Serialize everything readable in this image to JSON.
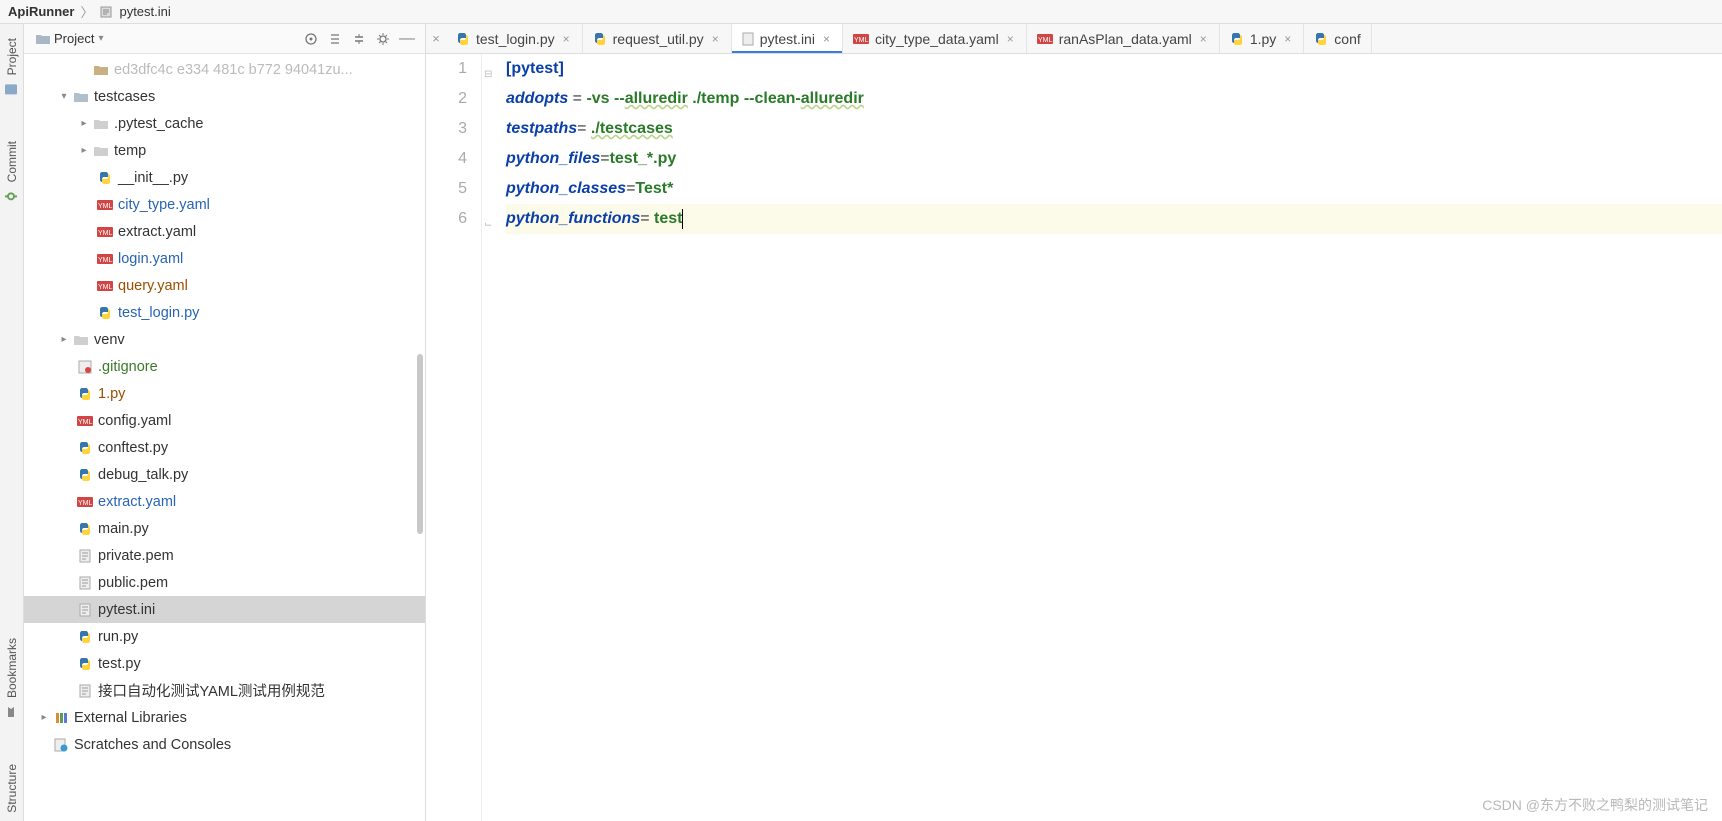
{
  "breadcrumb": {
    "root": "ApiRunner",
    "file": "pytest.ini"
  },
  "leftRail": {
    "project": "Project",
    "commit": "Commit",
    "bookmarks": "Bookmarks",
    "structure": "Structure"
  },
  "paneHeader": {
    "title": "Project"
  },
  "tree": {
    "truncated": "ed3dfc4c e334 481c b772 94041zu...",
    "testcases": "testcases",
    "pytest_cache": ".pytest_cache",
    "temp": "temp",
    "init_py": "__init__.py",
    "city_type_yaml": "city_type.yaml",
    "extract_yaml": "extract.yaml",
    "login_yaml": "login.yaml",
    "query_yaml": "query.yaml",
    "test_login_py": "test_login.py",
    "venv": "venv",
    "gitignore": ".gitignore",
    "one_py": "1.py",
    "config_yaml": "config.yaml",
    "conftest_py": "conftest.py",
    "debug_talk_py": "debug_talk.py",
    "extract_yaml_root": "extract.yaml",
    "main_py": "main.py",
    "private_pem": "private.pem",
    "public_pem": "public.pem",
    "pytest_ini": "pytest.ini",
    "run_py": "run.py",
    "test_py": "test.py",
    "doc_cn": "接口自动化测试YAML测试用例规范",
    "ext_libs": "External Libraries",
    "scratches": "Scratches and Consoles"
  },
  "tabs": [
    {
      "label": "test_login.py",
      "icon": "py"
    },
    {
      "label": "request_util.py",
      "icon": "py"
    },
    {
      "label": "pytest.ini",
      "icon": "ini",
      "active": true
    },
    {
      "label": "city_type_data.yaml",
      "icon": "yml"
    },
    {
      "label": "ranAsPlan_data.yaml",
      "icon": "yml"
    },
    {
      "label": "1.py",
      "icon": "py"
    },
    {
      "label": "conf",
      "icon": "py"
    }
  ],
  "code": {
    "l1_sec": "[pytest]",
    "l2_k": "addopts",
    "l2_op": " = ",
    "l2_v1": "-vs --",
    "l2_v2": "alluredir",
    "l2_v3": " ./temp --clean-",
    "l2_v4": "alluredir",
    "l3_k": "testpaths",
    "l3_op": "= ",
    "l3_v": "./testcases",
    "l4_k": "python_files",
    "l4_op": "=",
    "l4_v": "test_*.py",
    "l5_k": "python_classes",
    "l5_op": "=",
    "l5_v": "Test*",
    "l6_k": "python_functions",
    "l6_op": "= ",
    "l6_v": "test"
  },
  "lineNumbers": [
    "1",
    "2",
    "3",
    "4",
    "5",
    "6"
  ],
  "watermark": "CSDN @东方不败之鸭梨的测试笔记"
}
